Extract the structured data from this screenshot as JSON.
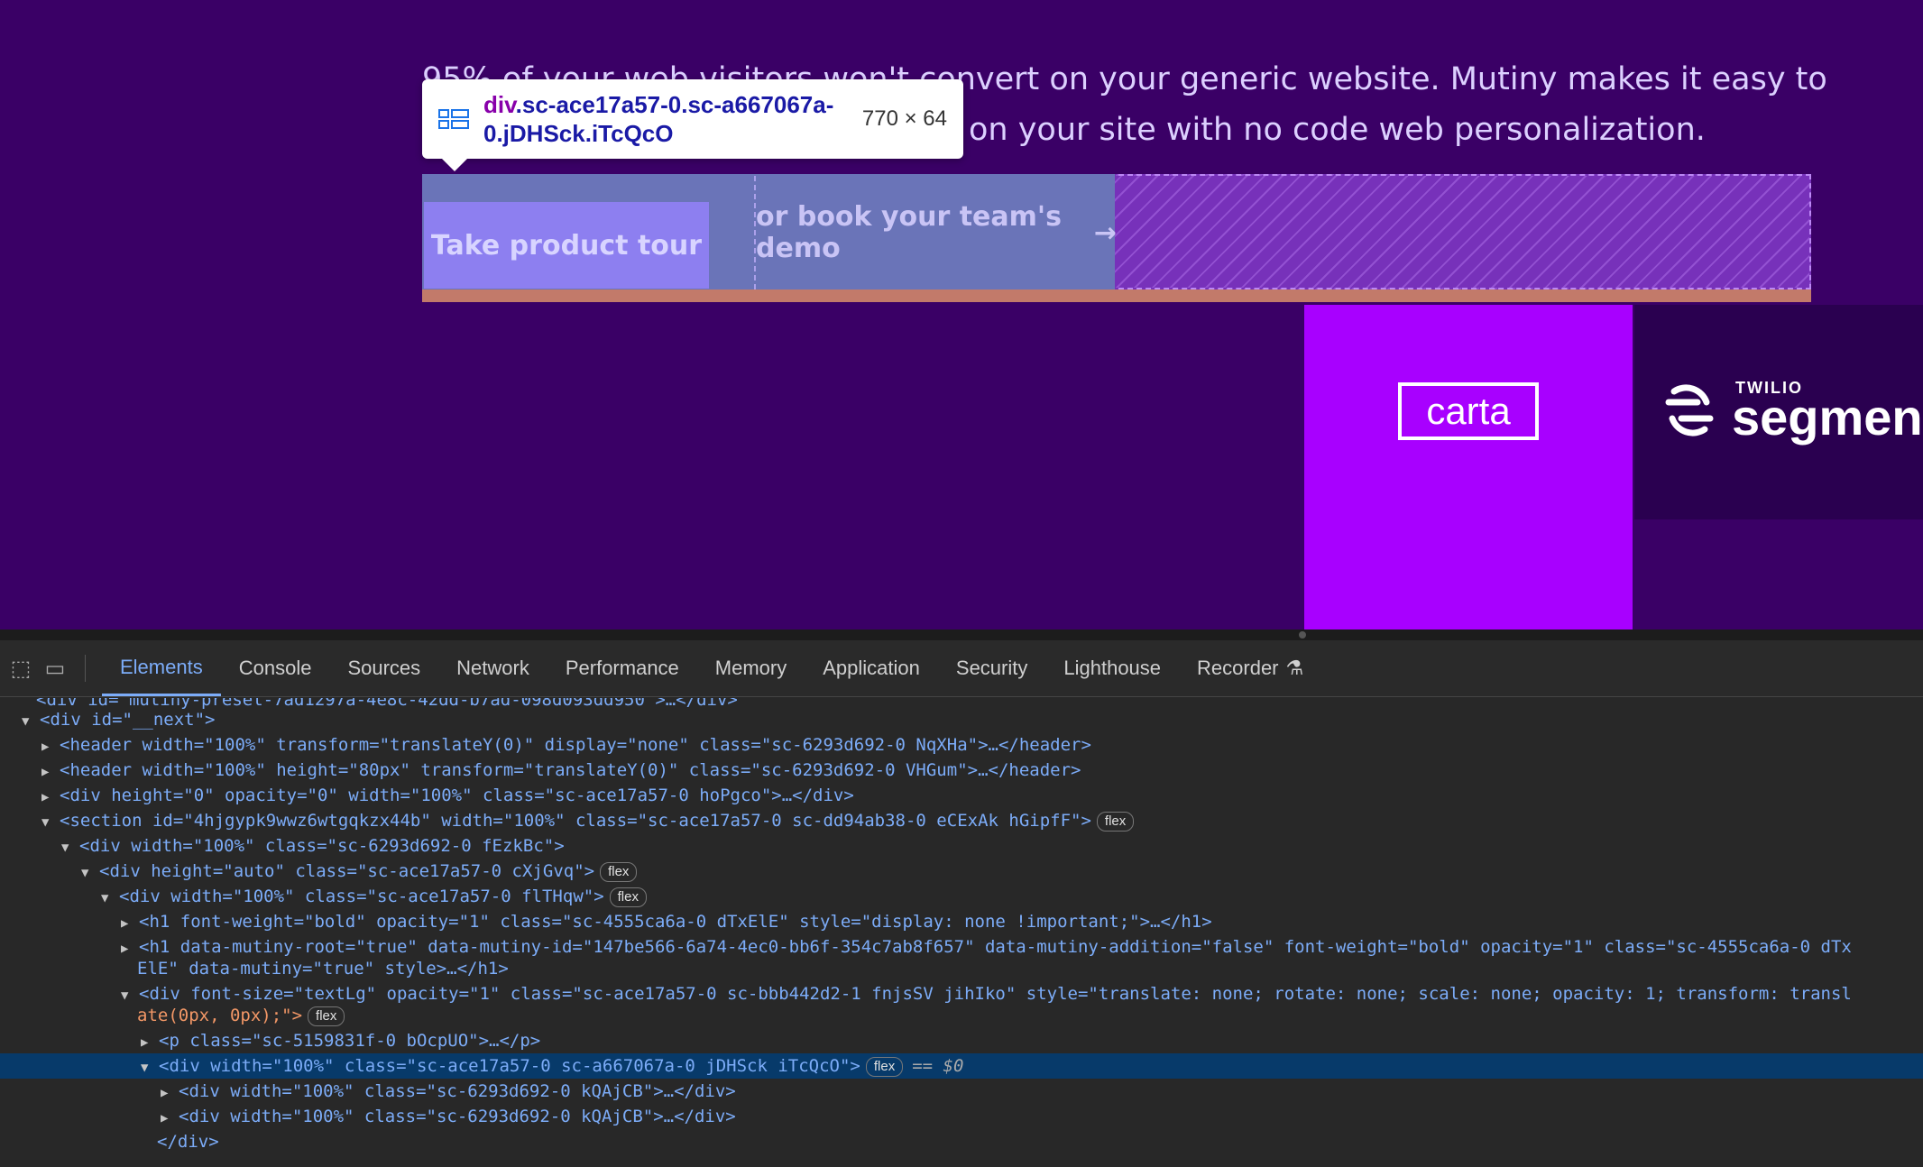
{
  "hero": {
    "line1": "95% of your web visitors won't convert on your generic website. Mutiny makes it easy to",
    "line2": "on your site with no code web personalization."
  },
  "buttons": {
    "tour_label": "Take product tour",
    "demo_label": "or book your team's demo",
    "demo_arrow": "→"
  },
  "tooltip": {
    "tag": "div",
    "selector": ".sc-ace17a57-0.sc-a667067a-0.jDHSck.iTcQcO",
    "size": "770 × 64"
  },
  "logos": {
    "carta": "carta",
    "segment_sub": "TWILIO",
    "segment_name": "segment"
  },
  "devtools": {
    "tabs": [
      "Elements",
      "Console",
      "Sources",
      "Network",
      "Performance",
      "Memory",
      "Application",
      "Security",
      "Lighthouse",
      "Recorder"
    ],
    "active_tab": "Elements",
    "selected_marker": "== $0",
    "rows": [
      "<div id=\"mutiny-preset-7ad1297a-4e8c-42dd-b7ad-098d093dd950\">…</div>",
      "<div id=\"__next\">",
      "<header width=\"100%\" transform=\"translateY(0)\" display=\"none\" class=\"sc-6293d692-0 NqXHa\">…</header>",
      "<header width=\"100%\" height=\"80px\" transform=\"translateY(0)\" class=\"sc-6293d692-0 VHGum\">…</header>",
      "<div height=\"0\" opacity=\"0\" width=\"100%\" class=\"sc-ace17a57-0 hoPgco\">…</div>",
      "<section id=\"4hjgypk9wwz6wtgqkzx44b\" width=\"100%\" class=\"sc-ace17a57-0 sc-dd94ab38-0 eCExAk hGipfF\">",
      "<div width=\"100%\" class=\"sc-6293d692-0 fEzkBc\">",
      "<div height=\"auto\" class=\"sc-ace17a57-0 cXjGvq\">",
      "<div width=\"100%\" class=\"sc-ace17a57-0 flTHqw\">",
      "<h1 font-weight=\"bold\" opacity=\"1\" class=\"sc-4555ca6a-0 dTxElE\" style=\"display: none !important;\">…</h1>",
      "<h1 data-mutiny-root=\"true\" data-mutiny-id=\"147be566-6a74-4ec0-bb6f-354c7ab8f657\" data-mutiny-addition=\"false\" font-weight=\"bold\" opacity=\"1\" class=\"sc-4555ca6a-0 dTx",
      "ElE\" data-mutiny=\"true\" style>…</h1>",
      "<div font-size=\"textLg\" opacity=\"1\" class=\"sc-ace17a57-0 sc-bbb442d2-1 fnjsSV jihIko\" style=\"translate: none; rotate: none; scale: none; opacity: 1; transform: transl",
      "ate(0px, 0px);\">",
      "<p class=\"sc-5159831f-0 bOcpUO\">…</p>",
      "<div width=\"100%\" class=\"sc-ace17a57-0 sc-a667067a-0 jDHSck iTcQcO\">",
      "<div width=\"100%\" class=\"sc-6293d692-0 kQAjCB\">…</div>",
      "<div width=\"100%\" class=\"sc-6293d692-0 kQAjCB\">…</div>",
      "</div>"
    ]
  },
  "colors": {
    "page_bg": "#3a0066",
    "accent_purple": "#a800ff",
    "devtools_bg": "#282828",
    "selected_row": "#073a6a"
  }
}
